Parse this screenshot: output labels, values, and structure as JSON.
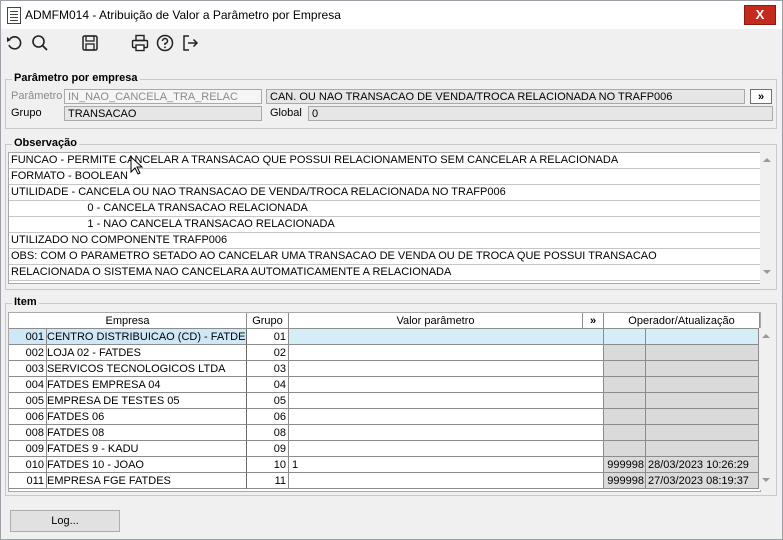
{
  "window": {
    "title": "ADMFM014 - Atribuição de Valor a Parâmetro por Empresa",
    "close_label": "X"
  },
  "toolbar": [
    "undo-icon",
    "search-icon",
    "save-icon",
    "print-icon",
    "help-icon",
    "exit-icon"
  ],
  "parametro": {
    "section_title": "Parâmetro por empresa",
    "parametro_label": "Parâmetro",
    "parametro_value": "IN_NAO_CANCELA_TRA_RELAC",
    "descricao_value": "CAN. OU NAO TRANSACAO DE VENDA/TROCA RELACIONADA NO TRAFP006",
    "expand_label": "»",
    "grupo_label": "Grupo",
    "grupo_value": "TRANSACAO",
    "global_label": "Global",
    "global_value": "0"
  },
  "observacao": {
    "section_title": "Observação",
    "lines": [
      "FUNCAO - PERMITE CANCELAR A TRANSACAO QUE POSSUI RELACIONAMENTO SEM CANCELAR A RELACIONADA",
      "FORMATO - BOOLEAN",
      "UTILIDADE - CANCELA OU NAO TRANSACAO DE VENDA/TROCA RELACIONADA NO TRAFP006",
      "                         0 - CANCELA TRANSACAO RELACIONADA",
      "                         1 - NAO CANCELA TRANSACAO RELACIONADA",
      "UTILIZADO NO COMPONENTE TRAFP006",
      "OBS: COM O PARAMETRO SETADO AO CANCELAR UMA TRANSACAO DE VENDA OU DE TROCA QUE POSSUI TRANSACAO",
      "RELACIONADA O SISTEMA NAO CANCELARA AUTOMATICAMENTE A RELACIONADA"
    ]
  },
  "item": {
    "section_title": "Item",
    "headers": {
      "empresa": "Empresa",
      "grupo": "Grupo",
      "valor": "Valor parâmetro",
      "expand": "»",
      "operador": "Operador/Atualização"
    },
    "rows": [
      {
        "code": "001",
        "name": "CENTRO DISTRIBUICAO (CD) - FATDES",
        "grupo": "01",
        "valor": "",
        "op": "",
        "dt": ""
      },
      {
        "code": "002",
        "name": "LOJA 02 - FATDES",
        "grupo": "02",
        "valor": "",
        "op": "",
        "dt": ""
      },
      {
        "code": "003",
        "name": "SERVICOS TECNOLOGICOS LTDA",
        "grupo": "03",
        "valor": "",
        "op": "",
        "dt": ""
      },
      {
        "code": "004",
        "name": "FATDES EMPRESA 04",
        "grupo": "04",
        "valor": "",
        "op": "",
        "dt": ""
      },
      {
        "code": "005",
        "name": "EMPRESA DE TESTES 05",
        "grupo": "05",
        "valor": "",
        "op": "",
        "dt": ""
      },
      {
        "code": "006",
        "name": "FATDES 06",
        "grupo": "06",
        "valor": "",
        "op": "",
        "dt": ""
      },
      {
        "code": "008",
        "name": "FATDES 08",
        "grupo": "08",
        "valor": "",
        "op": "",
        "dt": ""
      },
      {
        "code": "009",
        "name": "FATDES 9 - KADU",
        "grupo": "09",
        "valor": "",
        "op": "",
        "dt": ""
      },
      {
        "code": "010",
        "name": "FATDES 10 - JOAO",
        "grupo": "10",
        "valor": "1",
        "op": "999998",
        "dt": "28/03/2023 10:26:29"
      },
      {
        "code": "011",
        "name": "EMPRESA FGE FATDES",
        "grupo": "11",
        "valor": "",
        "op": "999998",
        "dt": "27/03/2023 08:19:37"
      }
    ]
  },
  "footer": {
    "log_label": "Log..."
  }
}
